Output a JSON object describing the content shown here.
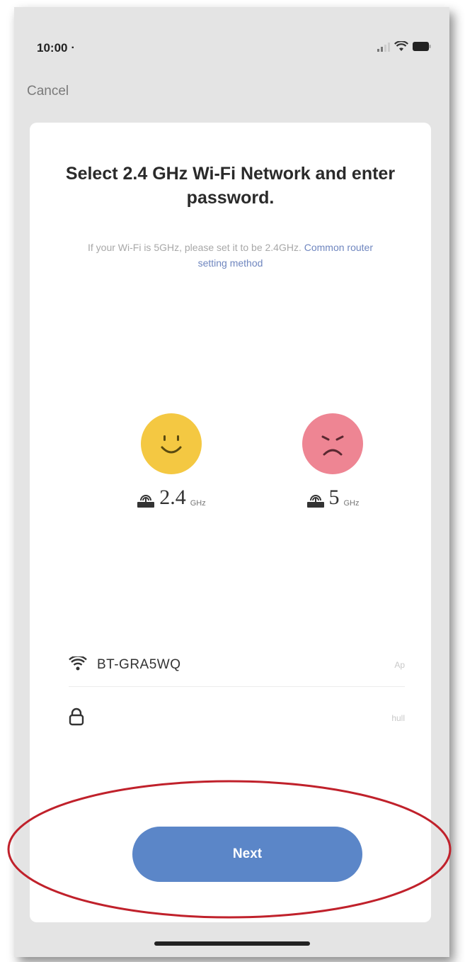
{
  "status_bar": {
    "time": "10:00 ᐧ"
  },
  "header": {
    "cancel_label": "Cancel"
  },
  "card": {
    "title": "Select 2.4 GHz Wi-Fi Network and enter password.",
    "subtitle_prefix": "If your Wi-Fi is 5GHz, please set it to be 2.4GHz. ",
    "subtitle_link": "Common router setting method",
    "bands": [
      {
        "value": "2.4",
        "unit": "GHz",
        "status": "supported",
        "face_icon": "happy-face-icon",
        "color": "#f4c842"
      },
      {
        "value": "5",
        "unit": "GHz",
        "status": "unsupported",
        "face_icon": "sad-face-icon",
        "color": "#ee8593"
      }
    ],
    "network": {
      "ssid": "BT-GRA5WQ",
      "change_label": "Ap"
    },
    "password": {
      "value": "",
      "placeholder": "",
      "toggle_label": "hull"
    },
    "next_label": "Next"
  },
  "colors": {
    "accent": "#5b86c8",
    "link": "#6f86bf",
    "annotation": "#c0212b"
  }
}
